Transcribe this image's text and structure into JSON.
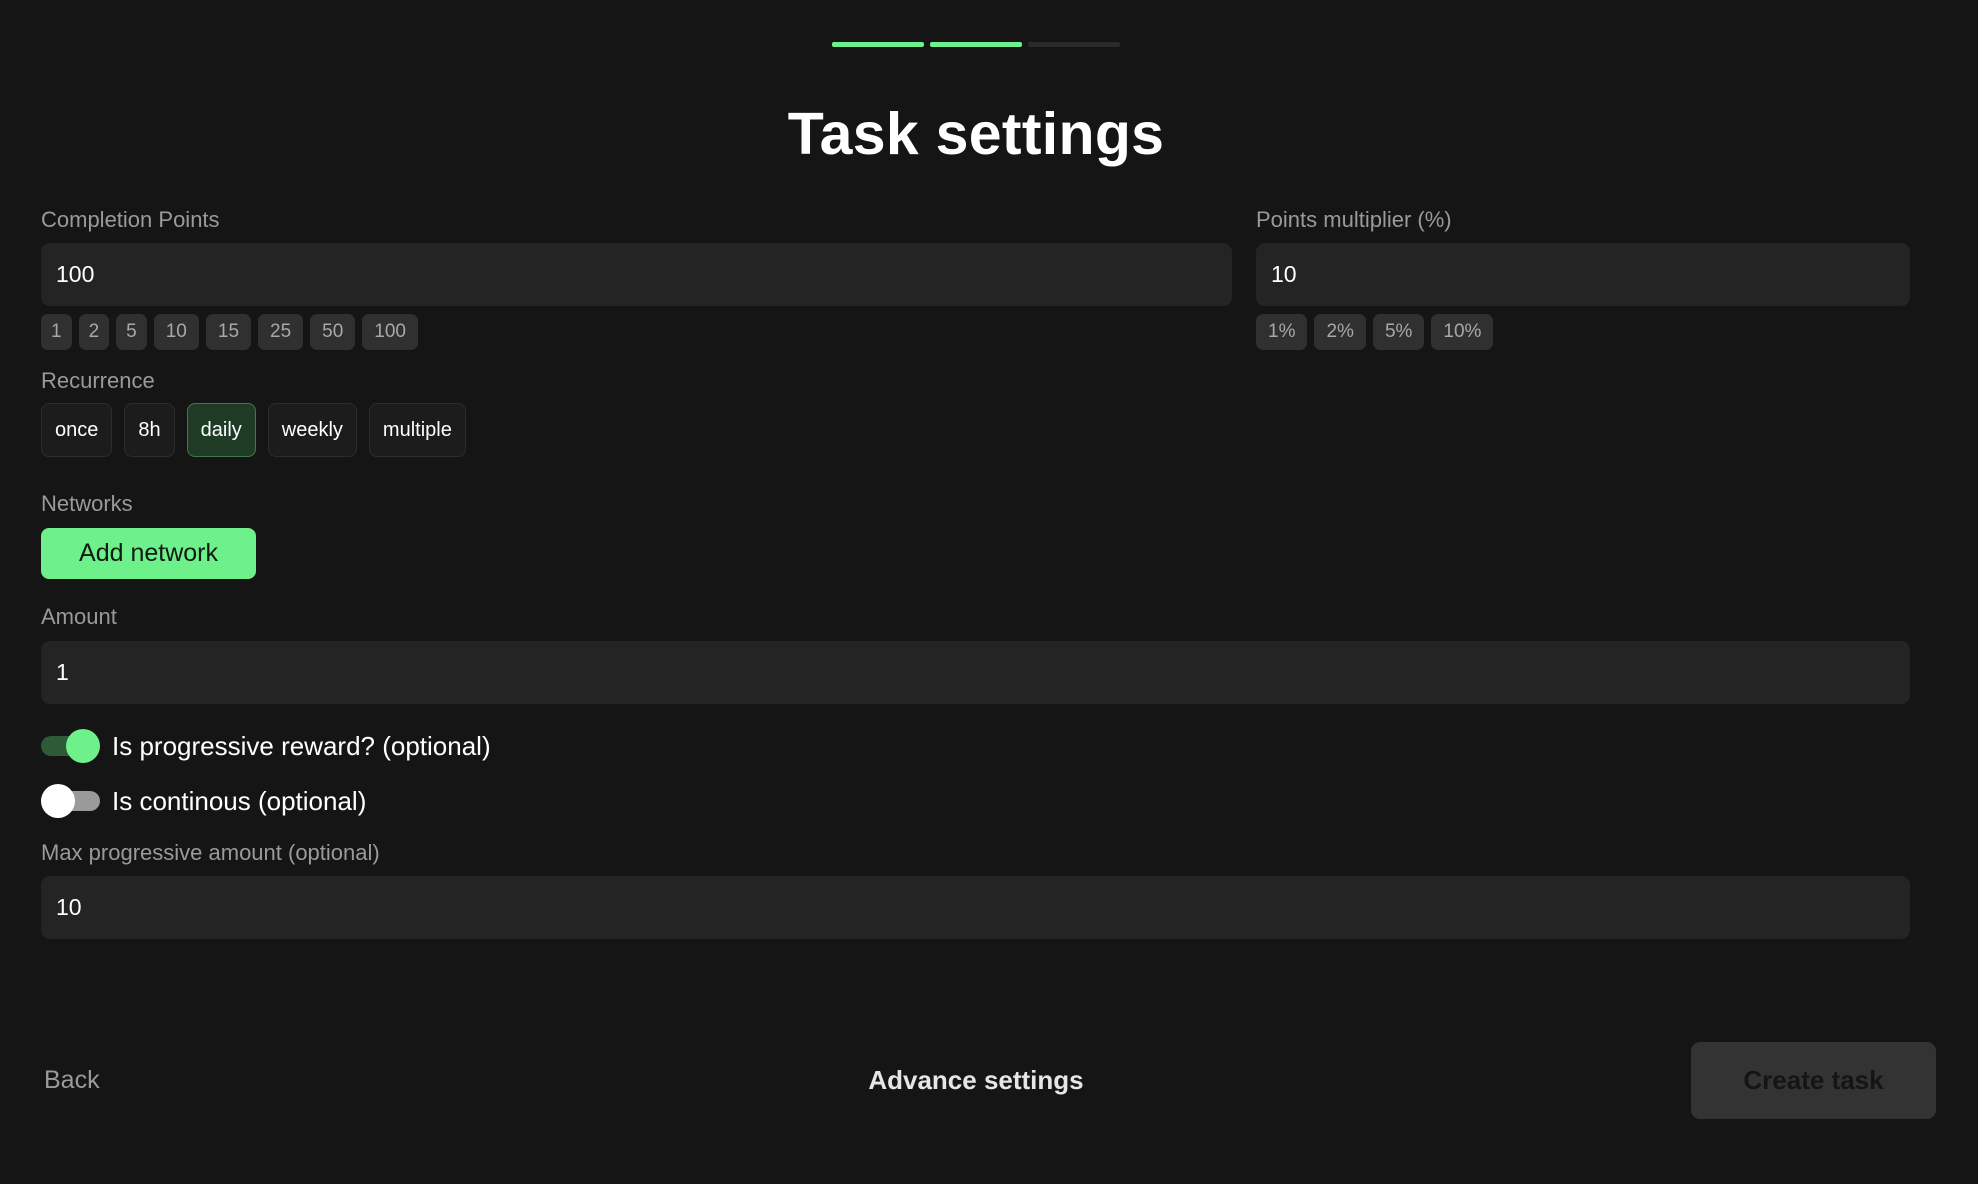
{
  "stepper": {
    "steps_total": 3,
    "steps_completed": 2,
    "accent": "#6ef08a"
  },
  "title": "Task settings",
  "completion_points": {
    "label": "Completion Points",
    "value": "100",
    "presets": [
      "1",
      "2",
      "5",
      "10",
      "15",
      "25",
      "50",
      "100"
    ]
  },
  "points_multiplier": {
    "label": "Points multiplier (%)",
    "value": "10",
    "presets": [
      "1%",
      "2%",
      "5%",
      "10%"
    ]
  },
  "recurrence": {
    "label": "Recurrence",
    "options": [
      "once",
      "8h",
      "daily",
      "weekly",
      "multiple"
    ],
    "selected": "daily"
  },
  "networks": {
    "label": "Networks",
    "add_label": "Add network"
  },
  "amount": {
    "label": "Amount",
    "value": "1"
  },
  "progressive_reward": {
    "label": "Is progressive reward? (optional)",
    "on": true
  },
  "continuous": {
    "label": "Is continous (optional)",
    "on": false
  },
  "max_progressive": {
    "label": "Max progressive amount (optional)",
    "value": "10"
  },
  "footer": {
    "back_label": "Back",
    "advance_label": "Advance settings",
    "create_label": "Create task"
  },
  "colors": {
    "background": "#151515",
    "accent": "#6ef08a",
    "field": "#242424",
    "muted_text": "#9a9a9a"
  }
}
